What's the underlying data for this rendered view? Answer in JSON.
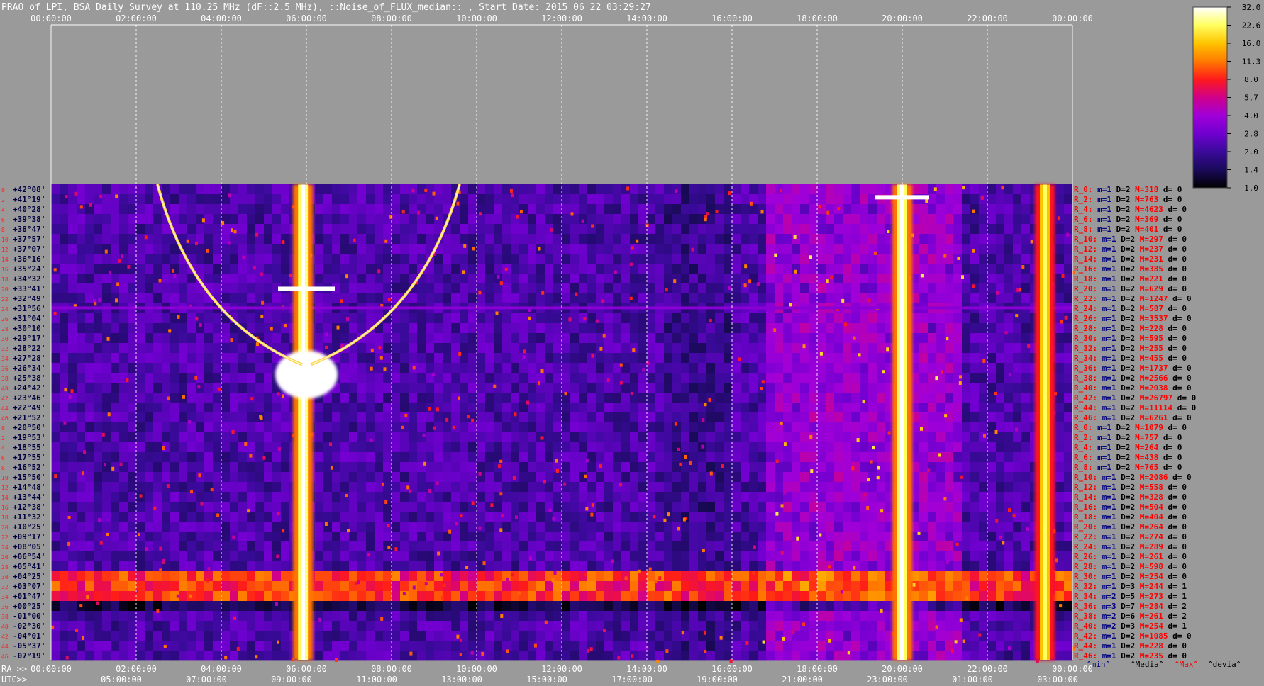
{
  "title": "PRAO of LPI, BSA Daily Survey at 110.25 MHz (dF::2.5 MHz), ::Noise_of_FLUX_median:: , Start Date: 2015 06 22 03:29:27",
  "chart_data": {
    "type": "heatmap",
    "title": "PRAO of LPI, BSA Daily Survey at 110.25 MHz (dF::2.5 MHz), ::Noise_of_FLUX_median:: , Start Date: 2015 06 22 03:29:27",
    "ra_axis_label": "RA >>",
    "utc_axis_label": "UTC>>",
    "ra_ticks": [
      "00:00:00",
      "02:00:00",
      "04:00:00",
      "06:00:00",
      "08:00:00",
      "10:00:00",
      "12:00:00",
      "14:00:00",
      "16:00:00",
      "18:00:00",
      "20:00:00",
      "22:00:00",
      "00:00:00"
    ],
    "utc_ticks": [
      "05:00:00",
      "07:00:00",
      "09:00:00",
      "11:00:00",
      "13:00:00",
      "15:00:00",
      "17:00:00",
      "19:00:00",
      "21:00:00",
      "23:00:00",
      "01:00:00",
      "03:00:00"
    ],
    "ra_range_hours": [
      0,
      24
    ],
    "dec_labels": [
      "+42°08'",
      "+41°19'",
      "+40°28'",
      "+39°38'",
      "+38°47'",
      "+37°57'",
      "+37°07'",
      "+36°16'",
      "+35°24'",
      "+34°32'",
      "+33°41'",
      "+32°49'",
      "+31°56'",
      "+31°04'",
      "+30°10'",
      "+29°17'",
      "+28°22'",
      "+27°28'",
      "+26°34'",
      "+25°38'",
      "+24°42'",
      "+23°46'",
      "+22°49'",
      "+21°52'",
      "+20°50'",
      "+19°53'",
      "+18°55'",
      "+17°55'",
      "+16°52'",
      "+15°50'",
      "+14°48'",
      "+13°44'",
      "+12°38'",
      "+11°32'",
      "+10°25'",
      "+09°17'",
      "+08°05'",
      "+06°54'",
      "+05°41'",
      "+04°25'",
      "+03°07'",
      "+01°47'",
      "+00°25'",
      "-01°00'",
      "-02°30'",
      "-04°01'",
      "-05°37'",
      "-07°19'"
    ],
    "beam_index_labels": [
      "0",
      "2",
      "4",
      "6",
      "8",
      "10",
      "12",
      "14",
      "16",
      "18",
      "20",
      "22",
      "24",
      "26",
      "28",
      "30",
      "32",
      "34",
      "36",
      "38",
      "40",
      "42",
      "44",
      "46",
      "0",
      "2",
      "4",
      "6",
      "8",
      "10",
      "12",
      "14",
      "16",
      "18",
      "20",
      "22",
      "24",
      "26",
      "28",
      "30",
      "32",
      "34",
      "36",
      "38",
      "40",
      "42",
      "44",
      "46"
    ],
    "colorbar": {
      "ticks": [
        "32.0",
        "22.6",
        "16.0",
        "11.3",
        "8.0",
        "5.7",
        "4.0",
        "2.8",
        "2.0",
        "1.4",
        "1.0"
      ],
      "range": [
        1.0,
        32.0
      ],
      "scale": "log",
      "colors": [
        "#000000",
        "#1a0a5a",
        "#5a00c0",
        "#9a00d8",
        "#d0008a",
        "#ff1a1a",
        "#ff8a00",
        "#ffd600",
        "#ffff90",
        "#ffffff"
      ]
    },
    "stats_rows": [
      {
        "r": "R_0:",
        "m": "m=1",
        "d": "D=2",
        "M": "M=318",
        "dv": "d= 0"
      },
      {
        "r": "R_2:",
        "m": "m=1",
        "d": "D=2",
        "M": "M=763",
        "dv": "d= 0"
      },
      {
        "r": "R_4:",
        "m": "m=1",
        "d": "D=2",
        "M": "M=4623",
        "dv": "d= 0"
      },
      {
        "r": "R_6:",
        "m": "m=1",
        "d": "D=2",
        "M": "M=369",
        "dv": "d= 0"
      },
      {
        "r": "R_8:",
        "m": "m=1",
        "d": "D=2",
        "M": "M=401",
        "dv": "d= 0"
      },
      {
        "r": "R_10:",
        "m": "m=1",
        "d": "D=2",
        "M": "M=297",
        "dv": "d= 0"
      },
      {
        "r": "R_12:",
        "m": "m=1",
        "d": "D=2",
        "M": "M=237",
        "dv": "d= 0"
      },
      {
        "r": "R_14:",
        "m": "m=1",
        "d": "D=2",
        "M": "M=231",
        "dv": "d= 0"
      },
      {
        "r": "R_16:",
        "m": "m=1",
        "d": "D=2",
        "M": "M=385",
        "dv": "d= 0"
      },
      {
        "r": "R_18:",
        "m": "m=1",
        "d": "D=2",
        "M": "M=221",
        "dv": "d= 0"
      },
      {
        "r": "R_20:",
        "m": "m=1",
        "d": "D=2",
        "M": "M=629",
        "dv": "d= 0"
      },
      {
        "r": "R_22:",
        "m": "m=1",
        "d": "D=2",
        "M": "M=1247",
        "dv": "d= 0"
      },
      {
        "r": "R_24:",
        "m": "m=1",
        "d": "D=2",
        "M": "M=587",
        "dv": "d= 0"
      },
      {
        "r": "R_26:",
        "m": "m=1",
        "d": "D=2",
        "M": "M=3537",
        "dv": "d= 0"
      },
      {
        "r": "R_28:",
        "m": "m=1",
        "d": "D=2",
        "M": "M=228",
        "dv": "d= 0"
      },
      {
        "r": "R_30:",
        "m": "m=1",
        "d": "D=2",
        "M": "M=595",
        "dv": "d= 0"
      },
      {
        "r": "R_32:",
        "m": "m=1",
        "d": "D=2",
        "M": "M=255",
        "dv": "d= 0"
      },
      {
        "r": "R_34:",
        "m": "m=1",
        "d": "D=2",
        "M": "M=455",
        "dv": "d= 0"
      },
      {
        "r": "R_36:",
        "m": "m=1",
        "d": "D=2",
        "M": "M=1737",
        "dv": "d= 0"
      },
      {
        "r": "R_38:",
        "m": "m=1",
        "d": "D=2",
        "M": "M=2566",
        "dv": "d= 0"
      },
      {
        "r": "R_40:",
        "m": "m=1",
        "d": "D=2",
        "M": "M=2038",
        "dv": "d= 0"
      },
      {
        "r": "R_42:",
        "m": "m=1",
        "d": "D=2",
        "M": "M=26797",
        "dv": "d= 0"
      },
      {
        "r": "R_44:",
        "m": "m=1",
        "d": "D=2",
        "M": "M=11114",
        "dv": "d= 0"
      },
      {
        "r": "R_46:",
        "m": "m=1",
        "d": "D=2",
        "M": "M=6261",
        "dv": "d= 0"
      },
      {
        "r": "R_0:",
        "m": "m=1",
        "d": "D=2",
        "M": "M=1079",
        "dv": "d= 0"
      },
      {
        "r": "R_2:",
        "m": "m=1",
        "d": "D=2",
        "M": "M=757",
        "dv": "d= 0"
      },
      {
        "r": "R_4:",
        "m": "m=1",
        "d": "D=2",
        "M": "M=264",
        "dv": "d= 0"
      },
      {
        "r": "R_6:",
        "m": "m=1",
        "d": "D=2",
        "M": "M=438",
        "dv": "d= 0"
      },
      {
        "r": "R_8:",
        "m": "m=1",
        "d": "D=2",
        "M": "M=765",
        "dv": "d= 0"
      },
      {
        "r": "R_10:",
        "m": "m=1",
        "d": "D=2",
        "M": "M=2086",
        "dv": "d= 0"
      },
      {
        "r": "R_12:",
        "m": "m=1",
        "d": "D=2",
        "M": "M=558",
        "dv": "d= 0"
      },
      {
        "r": "R_14:",
        "m": "m=1",
        "d": "D=2",
        "M": "M=328",
        "dv": "d= 0"
      },
      {
        "r": "R_16:",
        "m": "m=1",
        "d": "D=2",
        "M": "M=504",
        "dv": "d= 0"
      },
      {
        "r": "R_18:",
        "m": "m=1",
        "d": "D=2",
        "M": "M=404",
        "dv": "d= 0"
      },
      {
        "r": "R_20:",
        "m": "m=1",
        "d": "D=2",
        "M": "M=264",
        "dv": "d= 0"
      },
      {
        "r": "R_22:",
        "m": "m=1",
        "d": "D=2",
        "M": "M=274",
        "dv": "d= 0"
      },
      {
        "r": "R_24:",
        "m": "m=1",
        "d": "D=2",
        "M": "M=289",
        "dv": "d= 0"
      },
      {
        "r": "R_26:",
        "m": "m=1",
        "d": "D=2",
        "M": "M=261",
        "dv": "d= 0"
      },
      {
        "r": "R_28:",
        "m": "m=1",
        "d": "D=2",
        "M": "M=598",
        "dv": "d= 0"
      },
      {
        "r": "R_30:",
        "m": "m=1",
        "d": "D=2",
        "M": "M=254",
        "dv": "d= 0"
      },
      {
        "r": "R_32:",
        "m": "m=1",
        "d": "D=3",
        "M": "M=244",
        "dv": "d= 1"
      },
      {
        "r": "R_34:",
        "m": "m=2",
        "d": "D=5",
        "M": "M=273",
        "dv": "d= 1"
      },
      {
        "r": "R_36:",
        "m": "m=3",
        "d": "D=7",
        "M": "M=284",
        "dv": "d= 2"
      },
      {
        "r": "R_38:",
        "m": "m=2",
        "d": "D=6",
        "M": "M=261",
        "dv": "d= 2"
      },
      {
        "r": "R_40:",
        "m": "m=2",
        "d": "D=3",
        "M": "M=254",
        "dv": "d= 1"
      },
      {
        "r": "R_42:",
        "m": "m=1",
        "d": "D=2",
        "M": "M=1085",
        "dv": "d= 0"
      },
      {
        "r": "R_44:",
        "m": "m=1",
        "d": "D=2",
        "M": "M=228",
        "dv": "d= 0"
      },
      {
        "r": "R_46:",
        "m": "m=1",
        "d": "D=2",
        "M": "M=235",
        "dv": "d= 0"
      }
    ],
    "stats_legend": {
      "min": "^min^",
      "median": "^Media^",
      "max": "^Max^",
      "deviation": "^devia^"
    },
    "features": {
      "strong_sources": [
        {
          "ra_hours": 5.92,
          "dec_deg_range": [
            -7.3,
            42.1
          ],
          "peak": 32.0
        },
        {
          "ra_hours": 20.0,
          "dec_deg_range": [
            -7.3,
            42.1
          ],
          "peak": 32.0
        },
        {
          "ra_hours": 23.35,
          "dec_deg_range": [
            -7.3,
            42.1
          ],
          "peak": 22.6
        }
      ],
      "sun_crossing": {
        "ra_hours": 6.0,
        "dec_deg": 23.4
      },
      "arc_tracks": [
        {
          "ra_hours_top": 2.5,
          "ra_hours_bottom": 5.9
        },
        {
          "ra_hours_top": 9.6,
          "ra_hours_bottom": 6.1
        }
      ],
      "equatorial_band_dec_deg": [
        -1.0,
        1.8
      ],
      "horizontal_line_dec_deg": 29.3,
      "active_ra_hours_range": [
        16.7,
        21.5
      ]
    }
  }
}
